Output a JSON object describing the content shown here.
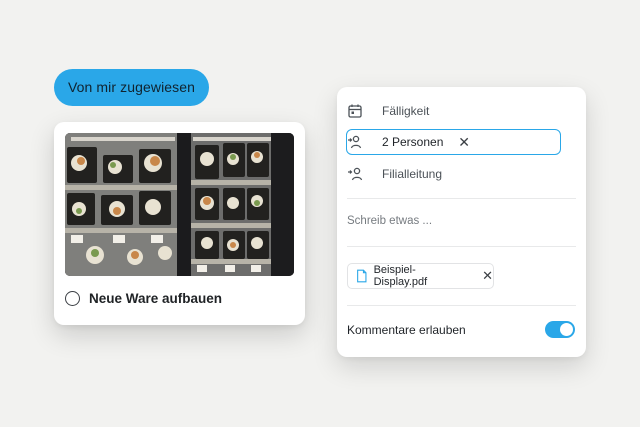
{
  "assigned_pill": {
    "label": "Von mir zugewiesen"
  },
  "task": {
    "title": "Neue Ware aufbauen",
    "photo_alt": "Food display showcase",
    "completed": false
  },
  "panel": {
    "due_label": "Fälligkeit",
    "persons_label": "2 Personen",
    "role_label": "Filialleitung",
    "comment_placeholder": "Schreib etwas ...",
    "attachment_name": "Beispiel-Display.pdf",
    "comments_label": "Kommentare erlauben",
    "comments_enabled": true
  },
  "colors": {
    "accent": "#2aa7e8",
    "background": "#f2f2f0"
  },
  "icons": {
    "due": "calendar-icon",
    "persons": "person-assign-icon",
    "role": "group-icon",
    "attachment": "file-icon",
    "remove": "close-icon"
  }
}
